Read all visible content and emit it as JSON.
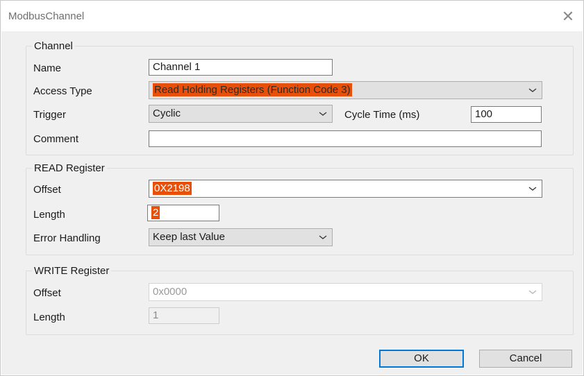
{
  "window": {
    "title": "ModbusChannel",
    "close_glyph": "✕"
  },
  "channel": {
    "legend": "Channel",
    "name_label": "Name",
    "name_value": "Channel 1",
    "access_label": "Access Type",
    "access_value": "Read Holding Registers (Function Code 3)",
    "trigger_label": "Trigger",
    "trigger_value": "Cyclic",
    "cycle_label": "Cycle Time (ms)",
    "cycle_value": "100",
    "comment_label": "Comment",
    "comment_value": ""
  },
  "read": {
    "legend": "READ Register",
    "offset_label": "Offset",
    "offset_value": "0X2198",
    "length_label": "Length",
    "length_value": "2",
    "error_label": "Error Handling",
    "error_value": "Keep last Value"
  },
  "write": {
    "legend": "WRITE Register",
    "offset_label": "Offset",
    "offset_value": "0x0000",
    "length_label": "Length",
    "length_value": "1"
  },
  "buttons": {
    "ok": "OK",
    "cancel": "Cancel"
  },
  "colors": {
    "highlight": "#e8500a",
    "default_button_border": "#0078d7",
    "client_bg": "#f0f0f0"
  },
  "icons": {
    "close": "close-icon",
    "dropdown": "chevron-down-icon"
  }
}
